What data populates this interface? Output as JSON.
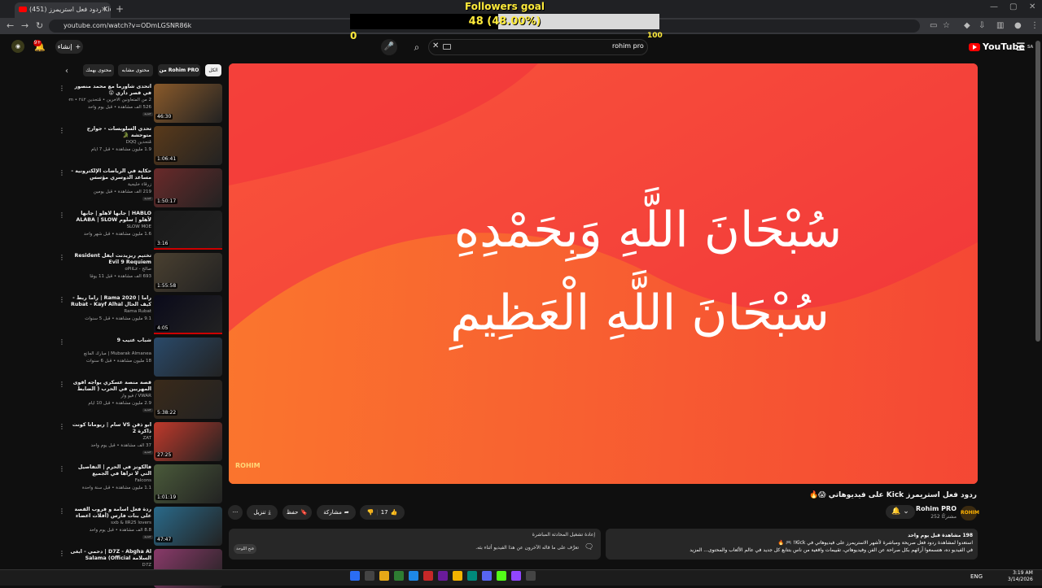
{
  "browser": {
    "tab_title": "(451) ردود فعل استريمرز Kick",
    "url": "youtube.com/watch?v=ODmLGSNR86k",
    "new_tab": "+",
    "close": "✕"
  },
  "overlay": {
    "goal_title": "Followers goal",
    "goal_text": "48 (48.00%)",
    "goal_progress": 0.48,
    "goal_min": "0",
    "goal_max": "100"
  },
  "header": {
    "logo": "YouTube",
    "logo_region": "SA",
    "search_value": "rohim pro",
    "create_label": "إنشاء",
    "notif_count": "9+"
  },
  "player": {
    "line1": "سُبْحَانَ اللَّهِ وَبِحَمْدِهِ",
    "line2": "سُبْحَانَ اللَّهِ الْعَظِيمِ",
    "watermark": "ROHIM"
  },
  "video": {
    "title": "ردود فعل استريمرز Kick على فيديوهاتي 😱🔥",
    "channel": "Rohim PRO",
    "subscribers": "252 مشتركًا",
    "like_count": "17",
    "share_label": "مشاركة",
    "save_label": "حفظ",
    "download_label": "تنزيل",
    "more_label": "···"
  },
  "description": {
    "meta": "198 مشاهدة  قبل يوم واحد",
    "line1": "استعدوا لمشاهدة ردود فعل صريحة ومباشرة لأشهر الاستريمرز على فيديوهاتي في Kick! 🎮 🔥",
    "line2": "في الفيديو ده، هتسمعوا آرائهم بكل صراحة عن الفن وفيديوهاتي، تقييمات واقعية من ناس بتتابع كل جديد في عالم الألعاب والمحتوى... المزيد"
  },
  "chat": {
    "header": "إعادة تشغيل المحادثة المباشرة",
    "body": "تعرَّف على ما قاله الآخرون عن هذا الفيديو أثناء بثه.",
    "button": "فتح اللوحة"
  },
  "chips": {
    "all": "الكل",
    "from": "من Rohim PRO",
    "similar": "محتوى مشابه",
    "yours": "محتوى يهمك"
  },
  "related": [
    {
      "title": "أتحدى شاورما مع محمد منصور في قصر داري 😲",
      "channel": "2 من المتعاونين الآخرين • مُتحدين ٢٤٢ • d7oom",
      "meta": "526 ألف مشاهدة • قبل يوم واحد",
      "badge": "جديد",
      "duration": "46:30",
      "progress": 0
    },
    {
      "title": "تحدي السلوبسات - جوارح متوحشة 🐊",
      "channel": "مُتحدين DQQ",
      "meta": "1.9 مليون مشاهدة • قبل 7 أيام",
      "badge": "",
      "duration": "1:06:41",
      "progress": 0
    },
    {
      "title": "حكاية في الرياضات الإلكترونية - مساعد الدوسري مؤسس روليكس فالكونز ضيف ...",
      "channel": "زرقاء خليجية",
      "meta": "219 ألف مشاهدة • قبل يومين",
      "badge": "جديد",
      "duration": "1:50:17",
      "progress": 0
    },
    {
      "title": "HABLO | جابها لأهلو | جابها لأهلو | سلوم ALABA | SLOW MOE | JABAHA",
      "channel": "SLOW MOE",
      "meta": "1.6 مليون مشاهدة • قبل شهر واحد",
      "badge": "",
      "duration": "3:16",
      "progress": 1
    },
    {
      "title": "تختيم ريزيدنت ايفل Resident Evil 9 Requiem",
      "channel": "صالح - oPiiLz",
      "meta": "693 ألف مشاهدة • قبل 11 يومًا",
      "badge": "",
      "duration": "1:55:58",
      "progress": 0
    },
    {
      "title": "راما | 2020 Rama | راما ربط - كيف الحال Rubat - Kayf Alhal",
      "channel": "Rama Rubat",
      "meta": "9.1 مليون مشاهدة • قبل 5 سنوات",
      "badge": "",
      "duration": "4:05",
      "progress": 1
    },
    {
      "title": "شباب عتيب 9",
      "channel": "Mubarak Almanea | مبارك المانع",
      "meta": "18 مليون مشاهدة • قبل 6 سنوات",
      "badge": "",
      "duration": "",
      "progress": 0
    },
    {
      "title": "قصة منصة عسكري يواجه أقوى المهربين في الحرب ( الضابط الغراب ) |",
      "channel": "VWAR / فيو وار",
      "meta": "2.9 مليون مشاهدة • قبل 10 أيام",
      "badge": "جديد",
      "duration": "5:38:22",
      "progress": 0
    },
    {
      "title": "أبو ذقن VS سام | ريومانا كونت ذاكرة 2",
      "channel": "ZAT",
      "meta": "37 ألف مشاهدة • قبل يوم واحد",
      "badge": "جديد",
      "duration": "27:25",
      "progress": 0
    },
    {
      "title": "فالكونز في الحرم | التفاصيل التي لا تراها في الجميع",
      "channel": "Falcons",
      "meta": "1.1 مليون مشاهدة • قبل سنة واحدة",
      "badge": "",
      "duration": "1:01:19",
      "progress": 0
    },
    {
      "title": "ردة فعل أسامة و فروب القصة على بنات فارس (أفلات اعضاء يلوس بطول اسهمهم ...",
      "channel": "sxb & IIR25 lovers",
      "meta": "8.8 ألف مشاهدة • قبل يوم واحد",
      "badge": "جديد",
      "duration": "47:47",
      "progress": 0
    },
    {
      "title": "D7Z - Abgha Al | دحمي - ابغى السلامة Salama (Official Music Video)",
      "channel": "D7Z",
      "meta": "",
      "badge": "",
      "duration": "",
      "progress": 0
    }
  ],
  "taskbar": {
    "lang": "ENG",
    "time": "3:19 AM",
    "date": "3/14/2026"
  },
  "colors": {
    "accent": "#ff0000",
    "goal_text": "#ffeb3b",
    "player_bg": "#f8402e"
  }
}
